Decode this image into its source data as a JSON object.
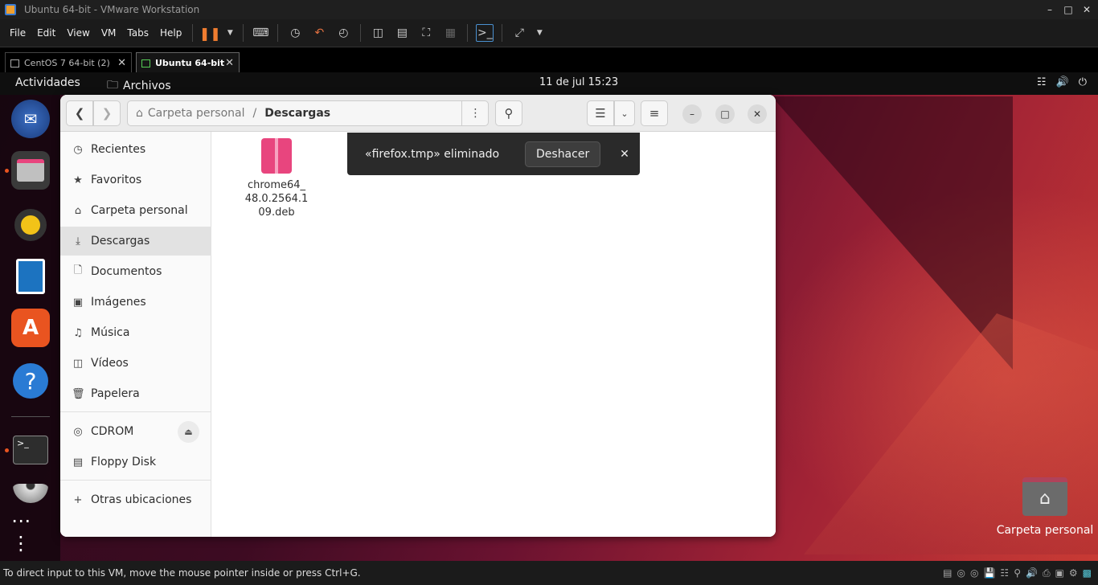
{
  "vmware": {
    "title": "Ubuntu 64-bit - VMware Workstation",
    "menu": [
      "File",
      "Edit",
      "View",
      "VM",
      "Tabs",
      "Help"
    ],
    "tabs": [
      {
        "label": "CentOS 7 64-bit (2)",
        "active": false
      },
      {
        "label": "Ubuntu 64-bit",
        "active": true
      }
    ],
    "status_text": "To direct input to this VM, move the mouse pointer inside or press Ctrl+G."
  },
  "gnome": {
    "activities": "Actividades",
    "app_name": "Archivos",
    "clock": "11 de jul  15:23"
  },
  "nautilus": {
    "path": {
      "parent": "Carpeta personal",
      "separator": "/",
      "current": "Descargas"
    },
    "sidebar": [
      {
        "label": "Recientes",
        "icon": "clock-icon"
      },
      {
        "label": "Favoritos",
        "icon": "star-icon"
      },
      {
        "label": "Carpeta personal",
        "icon": "home-icon"
      },
      {
        "label": "Descargas",
        "icon": "download-icon",
        "active": true
      },
      {
        "label": "Documentos",
        "icon": "document-icon"
      },
      {
        "label": "Imágenes",
        "icon": "image-icon"
      },
      {
        "label": "Música",
        "icon": "music-icon"
      },
      {
        "label": "Vídeos",
        "icon": "video-icon"
      },
      {
        "label": "Papelera",
        "icon": "trash-icon"
      }
    ],
    "devices": [
      {
        "label": "CDROM",
        "icon": "disc-icon"
      },
      {
        "label": "Floppy Disk",
        "icon": "drive-icon"
      }
    ],
    "other_locations": "Otras ubicaciones",
    "files": [
      {
        "name_lines": [
          "chrome64_",
          "48.0.2564.1",
          "09.deb"
        ]
      }
    ],
    "toast": {
      "message": "«firefox.tmp» eliminado",
      "undo_label": "Deshacer"
    }
  },
  "desktop": {
    "home_label": "Carpeta personal"
  },
  "colors": {
    "ubuntu_orange": "#e95420",
    "deb_pink": "#e8457e"
  }
}
